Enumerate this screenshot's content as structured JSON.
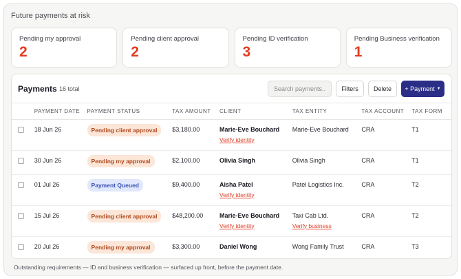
{
  "section_title": "Future payments at risk",
  "cards": [
    {
      "label": "Pending my approval",
      "value": "2"
    },
    {
      "label": "Pending client approval",
      "value": "2"
    },
    {
      "label": "Pending ID verification",
      "value": "3"
    },
    {
      "label": "Pending Business verification",
      "value": "1"
    }
  ],
  "table": {
    "title": "Payments",
    "count": "16 total",
    "search_placeholder": "Search payments...",
    "filters_label": "Filters",
    "delete_label": "Delete",
    "add_label": "+ Payment",
    "columns": [
      "PAYMENT DATE",
      "PAYMENT STATUS",
      "TAX AMOUNT",
      "CLIENT",
      "TAX ENTITY",
      "TAX ACCOUNT",
      "TAX FORM"
    ],
    "rows": [
      {
        "date": "18 Jun 26",
        "status": "Pending client approval",
        "amount": "$3,180.00",
        "client": "Marie-Eve Bouchard",
        "client_link": "Verify identity",
        "entity": "Marie-Eve Bouchard",
        "entity_link": "",
        "account": "CRA",
        "form": "T1"
      },
      {
        "date": "30 Jun 26",
        "status": "Pending my approval",
        "amount": "$2,100.00",
        "client": "Olivia Singh",
        "client_link": "",
        "entity": "Olivia Singh",
        "entity_link": "",
        "account": "CRA",
        "form": "T1"
      },
      {
        "date": "01 Jul 26",
        "status": "Payment Queued",
        "amount": "$9,400.00",
        "client": "Aisha Patel",
        "client_link": "Verify identity",
        "entity": "Patel Logistics Inc.",
        "entity_link": "",
        "account": "CRA",
        "form": "T2"
      },
      {
        "date": "15 Jul 26",
        "status": "Pending client approval",
        "amount": "$48,200.00",
        "client": "Marie-Eve Bouchard",
        "client_link": "Verify identity",
        "entity": "Taxi Cab Ltd.",
        "entity_link": "Verify business",
        "account": "CRA",
        "form": "T2"
      },
      {
        "date": "20 Jul 26",
        "status": "Pending my approval",
        "amount": "$3,300.00",
        "client": "Daniel Wong",
        "client_link": "",
        "entity": "Wong Family Trust",
        "entity_link": "",
        "account": "CRA",
        "form": "T3"
      }
    ]
  },
  "footer_note": "Outstanding requirements — ID and business verification — surfaced up front, before the payment date.",
  "colors": {
    "accent_red": "#e63b1f",
    "primary": "#2b2e86",
    "warn_bg": "#fbe6d8",
    "warn_text": "#b1491e",
    "info_bg": "#e1e8fb",
    "info_text": "#3853b3"
  }
}
